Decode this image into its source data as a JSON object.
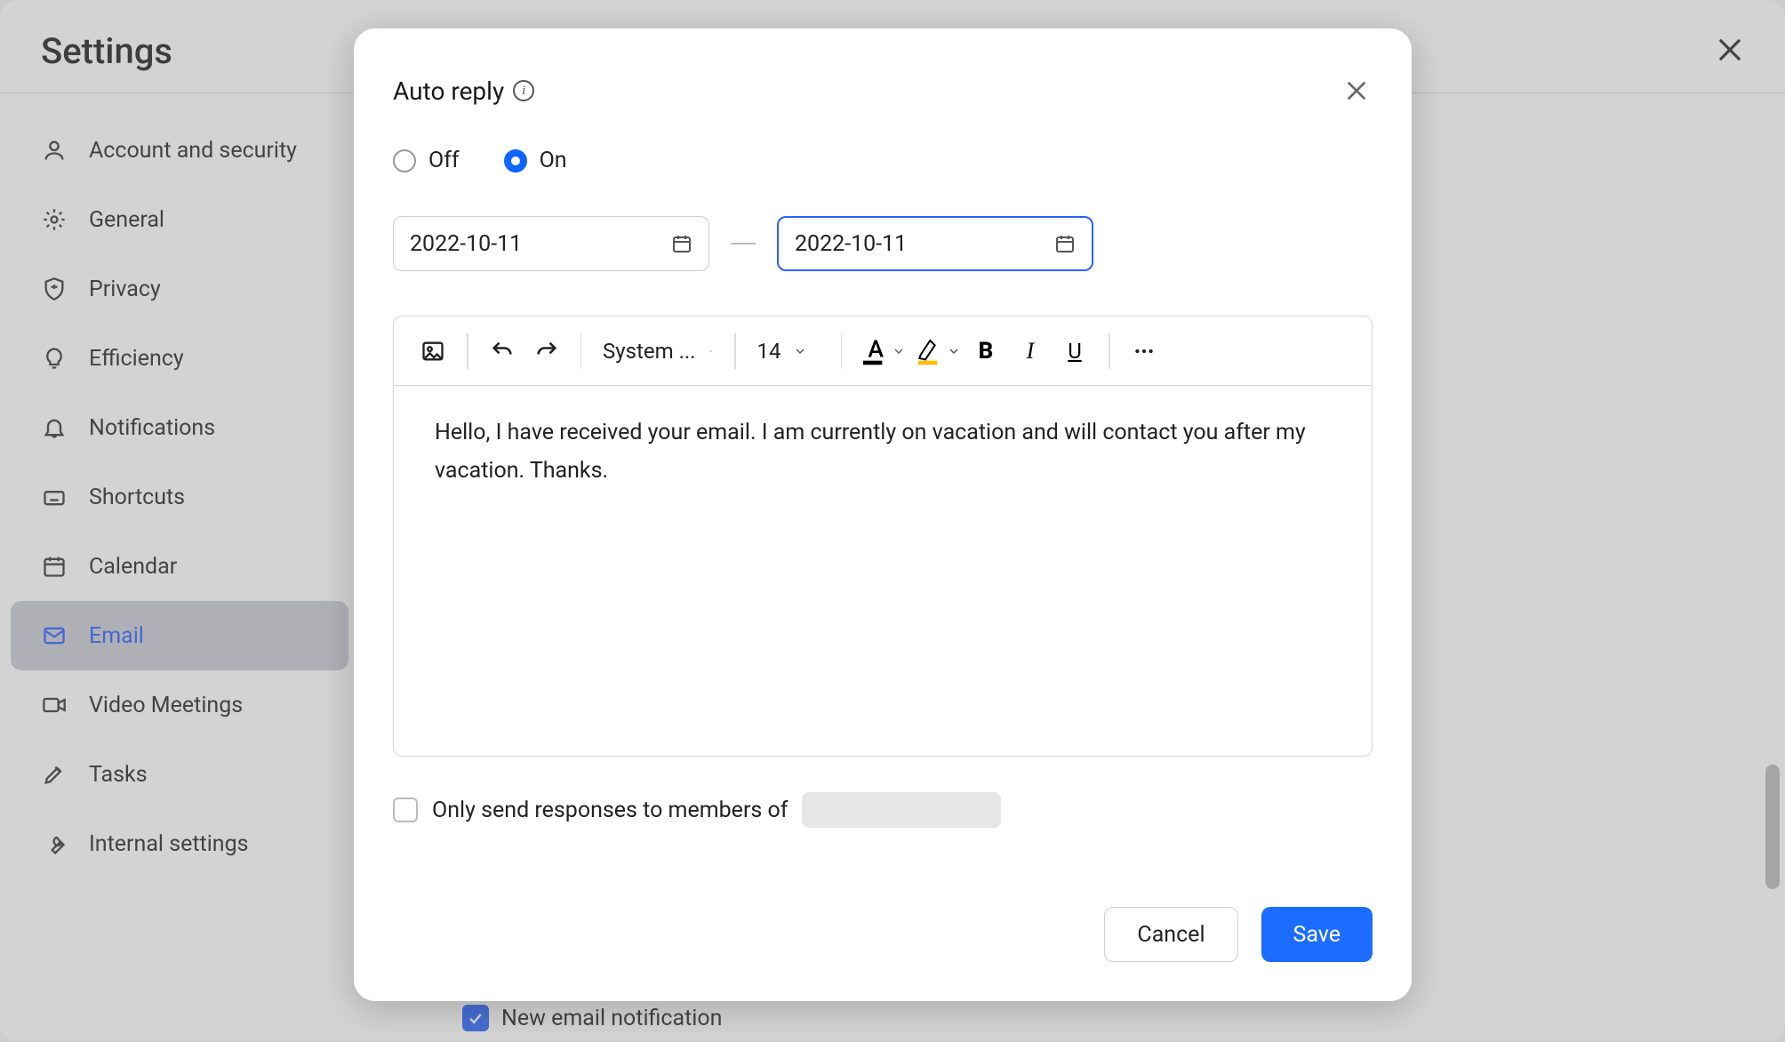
{
  "settings": {
    "title": "Settings",
    "sidebar": {
      "items": [
        {
          "label": "Account and security"
        },
        {
          "label": "General"
        },
        {
          "label": "Privacy"
        },
        {
          "label": "Efficiency"
        },
        {
          "label": "Notifications"
        },
        {
          "label": "Shortcuts"
        },
        {
          "label": "Calendar"
        },
        {
          "label": "Email"
        },
        {
          "label": "Video Meetings"
        },
        {
          "label": "Tasks"
        },
        {
          "label": "Internal settings"
        }
      ],
      "active_index": 7
    },
    "bg_checkbox_label": "New email notification"
  },
  "modal": {
    "title": "Auto reply",
    "radio": {
      "off_label": "Off",
      "on_label": "On",
      "selected": "on"
    },
    "dates": {
      "start": "2022-10-11",
      "end": "2022-10-11",
      "focused": "end"
    },
    "toolbar": {
      "font_family": "System ...",
      "font_size": "14"
    },
    "editor_body": "Hello, I have received your email. I am currently on vacation and will contact you after my vacation. Thanks.",
    "members_checkbox_label": "Only send responses to members of",
    "buttons": {
      "cancel": "Cancel",
      "save": "Save"
    }
  }
}
